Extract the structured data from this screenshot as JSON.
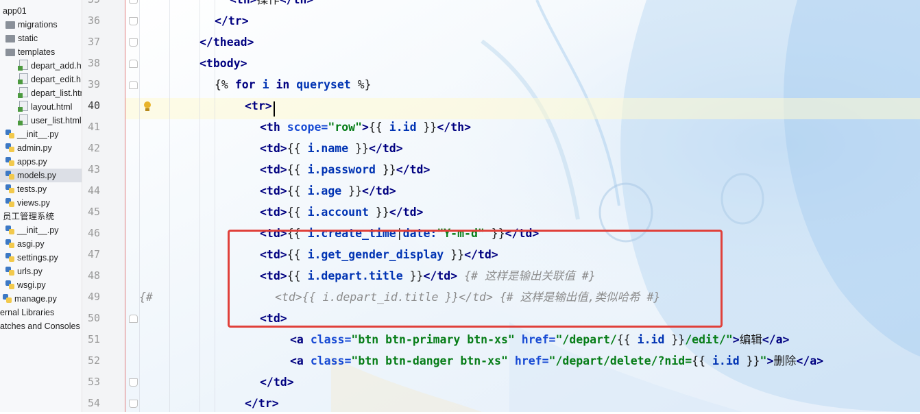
{
  "project_tree": [
    {
      "icon": "folder-icon",
      "label": "app01",
      "selected": false
    },
    {
      "icon": "folder-icon",
      "label": "migrations",
      "selected": false
    },
    {
      "icon": "folder-icon",
      "label": "static",
      "selected": false
    },
    {
      "icon": "folder-icon",
      "label": "templates",
      "selected": false
    },
    {
      "icon": "html-file-icon",
      "label": "depart_add.h",
      "selected": false
    },
    {
      "icon": "html-file-icon",
      "label": "depart_edit.h",
      "selected": false
    },
    {
      "icon": "html-file-icon",
      "label": "depart_list.htm",
      "selected": false
    },
    {
      "icon": "html-file-icon",
      "label": "layout.html",
      "selected": false
    },
    {
      "icon": "html-file-icon",
      "label": "user_list.html",
      "selected": false
    },
    {
      "icon": "python-file-icon",
      "label": "__init__.py",
      "selected": false
    },
    {
      "icon": "python-file-icon",
      "label": "admin.py",
      "selected": false
    },
    {
      "icon": "python-file-icon",
      "label": "apps.py",
      "selected": false
    },
    {
      "icon": "python-file-icon",
      "label": "models.py",
      "selected": true
    },
    {
      "icon": "python-file-icon",
      "label": "tests.py",
      "selected": false
    },
    {
      "icon": "python-file-icon",
      "label": "views.py",
      "selected": false
    },
    {
      "icon": "folder-icon",
      "label": "员工管理系统",
      "selected": false
    },
    {
      "icon": "python-file-icon",
      "label": "__init__.py",
      "selected": false
    },
    {
      "icon": "python-file-icon",
      "label": "asgi.py",
      "selected": false
    },
    {
      "icon": "python-file-icon",
      "label": "settings.py",
      "selected": false
    },
    {
      "icon": "python-file-icon",
      "label": "urls.py",
      "selected": false
    },
    {
      "icon": "python-file-icon",
      "label": "wsgi.py",
      "selected": false
    },
    {
      "icon": "python-file-icon",
      "label": "manage.py",
      "selected": false
    },
    {
      "icon": "library-icon",
      "label": "ernal Libraries",
      "selected": false
    },
    {
      "icon": "scratches-icon",
      "label": "atches and Consoles",
      "selected": false
    }
  ],
  "editor": {
    "current_line": 40,
    "lines": [
      {
        "n": "35",
        "segs": [
          [
            "t",
            "<th>"
          ],
          [
            "v",
            "操作"
          ],
          [
            "t",
            "</th>"
          ]
        ]
      },
      {
        "n": "36",
        "segs": [
          [
            "t",
            "</tr>"
          ]
        ]
      },
      {
        "n": "37",
        "segs": [
          [
            "t",
            "</thead>"
          ]
        ]
      },
      {
        "n": "38",
        "segs": [
          [
            "t",
            "<tbody>"
          ]
        ]
      },
      {
        "n": "39",
        "segs": [
          [
            "v",
            "{% "
          ],
          [
            "k",
            "for"
          ],
          [
            "v",
            " "
          ],
          [
            "tk",
            "i"
          ],
          [
            "v",
            " "
          ],
          [
            "k",
            "in"
          ],
          [
            "v",
            " "
          ],
          [
            "tk",
            "queryset"
          ],
          [
            "v",
            " %}"
          ]
        ]
      },
      {
        "n": "40",
        "segs": [
          [
            "t",
            "<tr>"
          ]
        ]
      },
      {
        "n": "41",
        "segs": [
          [
            "t",
            "<th "
          ],
          [
            "a",
            "scope="
          ],
          [
            "s",
            "\"row\""
          ],
          [
            "t",
            ">"
          ],
          [
            "v",
            "{{ "
          ],
          [
            "tk",
            "i.id"
          ],
          [
            "v",
            " }}"
          ],
          [
            "t",
            "</th>"
          ]
        ]
      },
      {
        "n": "42",
        "segs": [
          [
            "t",
            "<td>"
          ],
          [
            "v",
            "{{ "
          ],
          [
            "tk",
            "i.name"
          ],
          [
            "v",
            " }}"
          ],
          [
            "t",
            "</td>"
          ]
        ]
      },
      {
        "n": "43",
        "segs": [
          [
            "t",
            "<td>"
          ],
          [
            "v",
            "{{ "
          ],
          [
            "tk",
            "i.password"
          ],
          [
            "v",
            " }}"
          ],
          [
            "t",
            "</td>"
          ]
        ]
      },
      {
        "n": "44",
        "segs": [
          [
            "t",
            "<td>"
          ],
          [
            "v",
            "{{ "
          ],
          [
            "tk",
            "i.age"
          ],
          [
            "v",
            " }}"
          ],
          [
            "t",
            "</td>"
          ]
        ]
      },
      {
        "n": "45",
        "segs": [
          [
            "t",
            "<td>"
          ],
          [
            "v",
            "{{ "
          ],
          [
            "tk",
            "i.account"
          ],
          [
            "v",
            " }}"
          ],
          [
            "t",
            "</td>"
          ]
        ]
      },
      {
        "n": "46",
        "segs": [
          [
            "t",
            "<td>"
          ],
          [
            "v",
            "{{ "
          ],
          [
            "tk",
            "i.create_time"
          ],
          [
            "v",
            "|"
          ],
          [
            "tk",
            "date:"
          ],
          [
            "s",
            "\"Y-m-d\""
          ],
          [
            "v",
            " }}"
          ],
          [
            "t",
            "</td>"
          ]
        ]
      },
      {
        "n": "47",
        "segs": [
          [
            "t",
            "<td>"
          ],
          [
            "v",
            "{{ "
          ],
          [
            "tk",
            "i.get_gender_display"
          ],
          [
            "v",
            " }}"
          ],
          [
            "t",
            "</td>"
          ]
        ]
      },
      {
        "n": "48",
        "segs": [
          [
            "t",
            "<td>"
          ],
          [
            "v",
            "{{ "
          ],
          [
            "tk",
            "i.depart.title"
          ],
          [
            "v",
            " }}"
          ],
          [
            "t",
            "</td>"
          ],
          [
            "v",
            " "
          ],
          [
            "c",
            "{# 这样是输出关联值 #}"
          ]
        ]
      },
      {
        "n": "49",
        "segs": [
          [
            "c",
            "<td>{{ i.depart_id.title }}</td> {# 这样是输出值,类似哈希 #}"
          ]
        ]
      },
      {
        "n": "50",
        "segs": [
          [
            "t",
            "<td>"
          ]
        ]
      },
      {
        "n": "51",
        "segs": [
          [
            "t",
            "<a "
          ],
          [
            "a",
            "class="
          ],
          [
            "s",
            "\"btn btn-primary btn-xs\""
          ],
          [
            "v",
            " "
          ],
          [
            "a",
            "href="
          ],
          [
            "s",
            "\"/depart/"
          ],
          [
            "v",
            "{{ "
          ],
          [
            "tk",
            "i.id"
          ],
          [
            "v",
            " }}"
          ],
          [
            "s",
            "/edit/\""
          ],
          [
            "t",
            ">"
          ],
          [
            "v",
            "编辑"
          ],
          [
            "t",
            "</a>"
          ]
        ]
      },
      {
        "n": "52",
        "segs": [
          [
            "t",
            "<a "
          ],
          [
            "a",
            "class="
          ],
          [
            "s",
            "\"btn btn-danger btn-xs\""
          ],
          [
            "v",
            " "
          ],
          [
            "a",
            "href="
          ],
          [
            "s",
            "\"/depart/delete/?nid="
          ],
          [
            "v",
            "{{ "
          ],
          [
            "tk",
            "i.id"
          ],
          [
            "v",
            " }}"
          ],
          [
            "s",
            "\""
          ],
          [
            "t",
            ">"
          ],
          [
            "v",
            "删除"
          ],
          [
            "t",
            "</a>"
          ]
        ]
      },
      {
        "n": "53",
        "segs": [
          [
            "t",
            "</td>"
          ]
        ]
      },
      {
        "n": "54",
        "segs": [
          [
            "t",
            "</tr>"
          ]
        ]
      }
    ],
    "comment_prefix_line49": "{#"
  },
  "colors": {
    "tag": "#000080",
    "attr": "#174ad4",
    "string": "#067d17",
    "comment": "#8c8c8c",
    "highlight_box": "#e0403a",
    "current_line": "#fff9d2"
  }
}
